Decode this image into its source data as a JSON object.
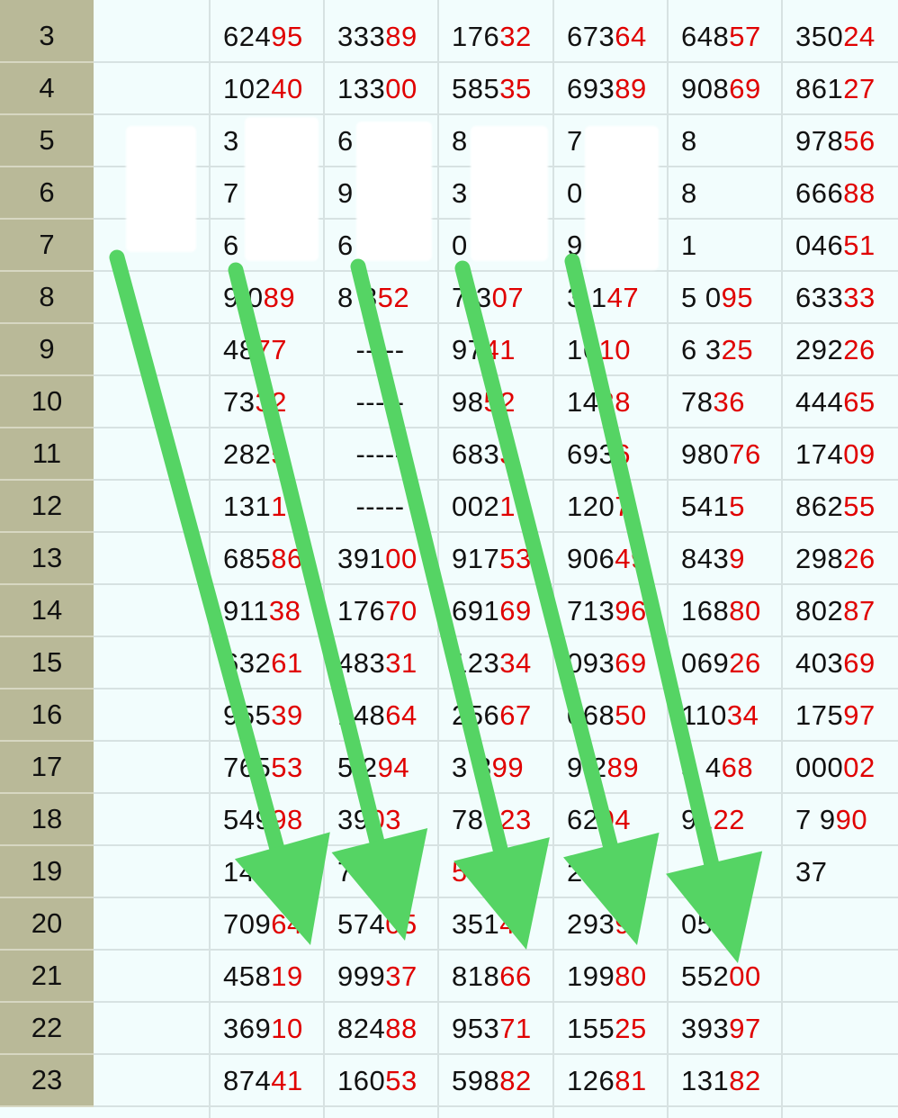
{
  "rows": [
    {
      "num": "3",
      "cells": [
        [
          "624",
          "95"
        ],
        [
          "333",
          "89"
        ],
        [
          "176",
          "32"
        ],
        [
          "673",
          "64"
        ],
        [
          "648",
          "57"
        ],
        [
          "350",
          "24"
        ]
      ]
    },
    {
      "num": "4",
      "cells": [
        [
          "102",
          "40"
        ],
        [
          "133",
          "00"
        ],
        [
          "585",
          "35"
        ],
        [
          "693",
          "89"
        ],
        [
          "908",
          "69"
        ],
        [
          "861",
          "27"
        ]
      ]
    },
    {
      "num": "5",
      "cells": [
        [
          "3",
          ""
        ],
        [
          "6",
          ""
        ],
        [
          "8",
          ""
        ],
        [
          "7",
          ""
        ],
        [
          "8",
          ""
        ],
        [
          "978",
          "56"
        ]
      ]
    },
    {
      "num": "6",
      "cells": [
        [
          "7",
          ""
        ],
        [
          "9",
          ""
        ],
        [
          "3",
          ""
        ],
        [
          "0",
          ""
        ],
        [
          "8",
          ""
        ],
        [
          "666",
          "88"
        ]
      ]
    },
    {
      "num": "7",
      "cells": [
        [
          "6",
          ""
        ],
        [
          "6",
          ""
        ],
        [
          "0",
          ""
        ],
        [
          "9",
          ""
        ],
        [
          "1",
          ""
        ],
        [
          "046",
          "51"
        ]
      ]
    },
    {
      "num": "8",
      "cells": [
        [
          "9 0",
          "89"
        ],
        [
          "8 8",
          "52"
        ],
        [
          "7 3",
          "07"
        ],
        [
          "3 1",
          "47"
        ],
        [
          "5 0",
          "95"
        ],
        [
          "633",
          "33"
        ]
      ]
    },
    {
      "num": "9",
      "cells": [
        [
          "48 ",
          "77"
        ],
        [
          "-----",
          ""
        ],
        [
          "97 ",
          "41"
        ],
        [
          "16 ",
          "10"
        ],
        [
          "6 3",
          "25"
        ],
        [
          "292",
          "26"
        ]
      ]
    },
    {
      "num": "10",
      "cells": [
        [
          "73 ",
          "32"
        ],
        [
          "-----",
          ""
        ],
        [
          "98 ",
          "52"
        ],
        [
          "14 ",
          "38"
        ],
        [
          "78 ",
          "36"
        ],
        [
          "444",
          "65"
        ]
      ]
    },
    {
      "num": "11",
      "cells": [
        [
          "282",
          "5"
        ],
        [
          "-----",
          ""
        ],
        [
          "683",
          "3"
        ],
        [
          "693",
          "6"
        ],
        [
          "980",
          "76"
        ],
        [
          "174",
          "09"
        ]
      ]
    },
    {
      "num": "12",
      "cells": [
        [
          "131",
          "1"
        ],
        [
          "-----",
          ""
        ],
        [
          "002",
          "1"
        ],
        [
          "120",
          "7"
        ],
        [
          "541",
          "5"
        ],
        [
          "862",
          "55"
        ]
      ]
    },
    {
      "num": "13",
      "cells": [
        [
          "685",
          "86"
        ],
        [
          "391",
          "00"
        ],
        [
          "917",
          "53"
        ],
        [
          "906",
          "49"
        ],
        [
          "843",
          "9"
        ],
        [
          "298",
          "26"
        ]
      ]
    },
    {
      "num": "14",
      "cells": [
        [
          "911",
          "38"
        ],
        [
          "176",
          "70"
        ],
        [
          "691",
          "69"
        ],
        [
          "713",
          "96"
        ],
        [
          "168",
          "80"
        ],
        [
          "802",
          "87"
        ]
      ]
    },
    {
      "num": "15",
      "cells": [
        [
          "632",
          "61"
        ],
        [
          "483",
          "31"
        ],
        [
          "123",
          "34"
        ],
        [
          "093",
          "69"
        ],
        [
          "069",
          "26"
        ],
        [
          "403",
          "69"
        ]
      ]
    },
    {
      "num": "16",
      "cells": [
        [
          "955",
          "39"
        ],
        [
          "148",
          "64"
        ],
        [
          "256",
          "67"
        ],
        [
          "068",
          "50"
        ],
        [
          "110",
          "34"
        ],
        [
          "175",
          "97"
        ]
      ]
    },
    {
      "num": "17",
      "cells": [
        [
          "765",
          "53"
        ],
        [
          "5 2",
          "94"
        ],
        [
          "3 3",
          "99"
        ],
        [
          "9 2",
          "89"
        ],
        [
          "5 4",
          "68"
        ],
        [
          "000",
          "02"
        ]
      ]
    },
    {
      "num": "18",
      "cells": [
        [
          "549",
          "98"
        ],
        [
          "39 ",
          "03"
        ],
        [
          "787",
          "23"
        ],
        [
          "62 ",
          "04"
        ],
        [
          "91 ",
          "22"
        ],
        [
          "7 9",
          "90"
        ]
      ]
    },
    {
      "num": "19",
      "cells": [
        [
          "146",
          "09"
        ],
        [
          "7",
          "  "
        ],
        [
          "  ",
          "5"
        ],
        [
          "2",
          ""
        ],
        [
          "",
          ""
        ],
        [
          "37",
          ""
        ]
      ]
    },
    {
      "num": "20",
      "cells": [
        [
          "709",
          "64"
        ],
        [
          "574",
          "05"
        ],
        [
          "351",
          "4"
        ],
        [
          "293",
          "9"
        ],
        [
          "059",
          "6"
        ],
        [
          "",
          ""
        ]
      ]
    },
    {
      "num": "21",
      "cells": [
        [
          "458",
          "19"
        ],
        [
          "999",
          "37"
        ],
        [
          "818",
          "66"
        ],
        [
          "199",
          "80"
        ],
        [
          "552",
          "00"
        ],
        [
          "",
          ""
        ]
      ]
    },
    {
      "num": "22",
      "cells": [
        [
          "369",
          "10"
        ],
        [
          "824",
          "88"
        ],
        [
          "953",
          "71"
        ],
        [
          "155",
          "25"
        ],
        [
          "393",
          "97"
        ],
        [
          "",
          ""
        ]
      ]
    },
    {
      "num": "23",
      "cells": [
        [
          "874",
          "41"
        ],
        [
          "160",
          "53"
        ],
        [
          "598",
          "82"
        ],
        [
          "126",
          "81"
        ],
        [
          "131",
          "82"
        ],
        [
          "",
          ""
        ]
      ]
    }
  ],
  "colors": {
    "arrow": "#55d464",
    "red": "#e00000",
    "rowhead": "#b9b998",
    "grid": "#d7e2e2",
    "bg": "#f2fdfd"
  }
}
